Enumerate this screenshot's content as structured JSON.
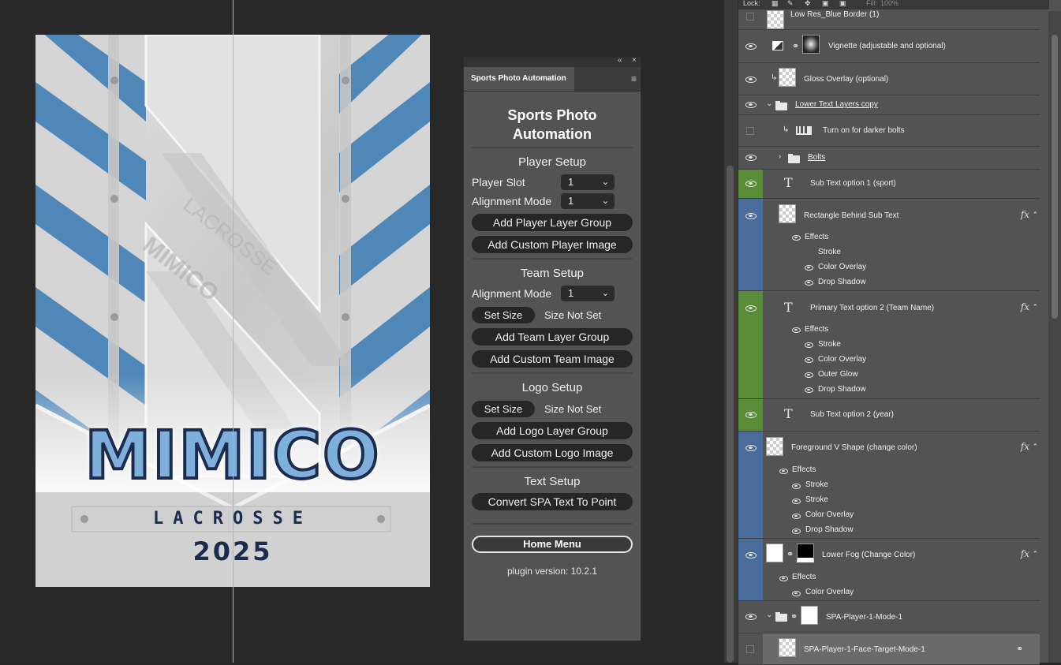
{
  "poster": {
    "team_name": "MIMICO",
    "sport": "LACROSSE",
    "year": "2025",
    "watermark_words": [
      "MIMICO",
      "LACROSSE"
    ],
    "colors": {
      "stripe_blue": "#4f87b8",
      "navy": "#1c2c4f",
      "metal": "#d6d6d6"
    }
  },
  "plugin": {
    "tab_label": "Sports Photo Automation",
    "title_line1": "Sports Photo",
    "title_line2": "Automation",
    "titlebar_collapse": "«",
    "titlebar_close": "×",
    "menu_icon": "≡",
    "player": {
      "heading": "Player Setup",
      "slot_label": "Player Slot",
      "slot_value": "1",
      "align_label": "Alignment Mode",
      "align_value": "1",
      "add_group": "Add Player Layer Group",
      "add_image": "Add Custom Player Image"
    },
    "team": {
      "heading": "Team Setup",
      "align_label": "Alignment Mode",
      "align_value": "1",
      "set_size": "Set Size",
      "size_status": "Size Not Set",
      "add_group": "Add Team Layer Group",
      "add_image": "Add Custom Team Image"
    },
    "logo": {
      "heading": "Logo Setup",
      "set_size": "Set Size",
      "size_status": "Size Not Set",
      "add_group": "Add Logo Layer Group",
      "add_image": "Add Custom Logo Image"
    },
    "text": {
      "heading": "Text Setup",
      "convert": "Convert SPA Text To Point"
    },
    "home": "Home Menu",
    "version": "plugin version: 10.2.1"
  },
  "layers_panel": {
    "lock_label": "Lock:",
    "fill_label": "Fill:",
    "fill_value": "100%",
    "layers": [
      {
        "name": "Low Res_Blue Border (1)"
      },
      {
        "name": "Vignette (adjustable and optional)"
      },
      {
        "name": "Gloss Overlay (optional)"
      },
      {
        "name": "Lower Text Layers copy"
      },
      {
        "name": "Turn on for darker bolts"
      },
      {
        "name": "Bolts"
      },
      {
        "name": "Sub Text option 1 (sport)"
      },
      {
        "name": "Rectangle Behind Sub Text",
        "effects": [
          "Effects",
          "Stroke",
          "Color Overlay",
          "Drop Shadow"
        ]
      },
      {
        "name": "Primary Text option 2 (Team Name)",
        "effects": [
          "Effects",
          "Stroke",
          "Color Overlay",
          "Outer Glow",
          "Drop Shadow"
        ]
      },
      {
        "name": "Sub Text option 2 (year)"
      },
      {
        "name": "Foreground V Shape (change color)",
        "effects": [
          "Effects",
          "Stroke",
          "Stroke",
          "Color Overlay",
          "Drop Shadow"
        ]
      },
      {
        "name": "Lower Fog (Change Color)",
        "effects": [
          "Effects",
          "Color Overlay"
        ]
      },
      {
        "name": "SPA-Player-1-Mode-1"
      },
      {
        "name": "SPA-Player-1-Face-Target-Mode-1"
      }
    ],
    "fx_label": "fx",
    "text_icon": "T"
  }
}
